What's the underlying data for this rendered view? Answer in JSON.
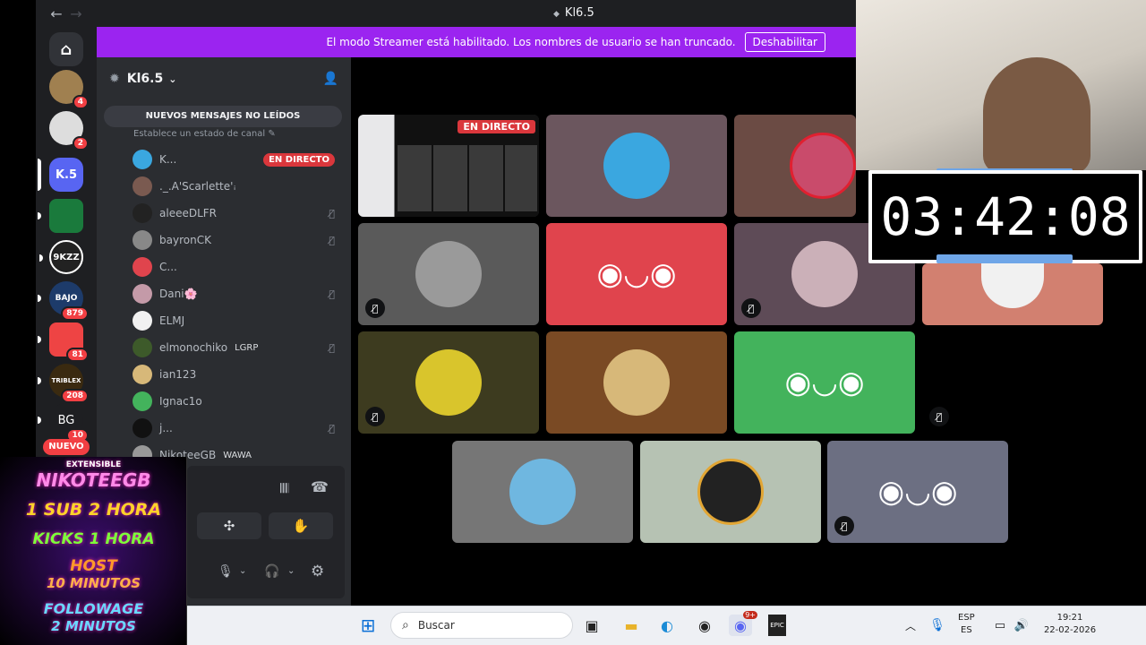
{
  "window": {
    "title": "Kl6.5",
    "back": "←",
    "forward": "→"
  },
  "banner": {
    "text": "El modo Streamer está habilitado. Los nombres de usuario se han truncado.",
    "button": "Deshabilitar"
  },
  "rail": {
    "servers": [
      {
        "label": "",
        "badge": "",
        "color": "#5865f2"
      },
      {
        "label": "",
        "badge": "4",
        "color": "#a08050"
      },
      {
        "label": "",
        "badge": "2",
        "color": "#222"
      },
      {
        "label": "K.5",
        "badge": "",
        "color": "#5865f2"
      },
      {
        "label": "",
        "badge": "",
        "color": "#1a7a3c"
      },
      {
        "label": "9KZZ",
        "badge": "",
        "color": "#222"
      },
      {
        "label": "BAJO",
        "badge": "879",
        "color": "#1d3b6a"
      },
      {
        "label": "",
        "badge": "81",
        "color": "#e44"
      },
      {
        "label": "TRIBLEX",
        "badge": "208",
        "color": "#3a2a10"
      },
      {
        "label": "BG",
        "badge": "10",
        "color": "#1e1f22"
      }
    ],
    "nuevo": "NUEVO"
  },
  "guild": {
    "name": "Kl6.5"
  },
  "channel": {
    "new_messages": "NUEVOS MENSAJES NO LEÍDOS",
    "status_hint": "Establece un estado de canal",
    "live_label": "EN DIRECTO",
    "members": [
      {
        "name": "K...",
        "live": true,
        "muted": false,
        "tag": ""
      },
      {
        "name": "._.A'Scarlette'ꜟ",
        "live": false,
        "muted": false,
        "tag": ""
      },
      {
        "name": "aleeeDLFR",
        "live": false,
        "muted": true,
        "tag": ""
      },
      {
        "name": "bayronCK",
        "live": false,
        "muted": true,
        "tag": ""
      },
      {
        "name": "C...",
        "live": false,
        "muted": false,
        "tag": ""
      },
      {
        "name": "Dani🌸",
        "live": false,
        "muted": true,
        "tag": ""
      },
      {
        "name": "ELMJ",
        "live": false,
        "muted": false,
        "tag": ""
      },
      {
        "name": "elmonochiko",
        "live": false,
        "muted": true,
        "tag": "LGRP"
      },
      {
        "name": "ian123",
        "live": false,
        "muted": false,
        "tag": ""
      },
      {
        "name": "Ignac1o",
        "live": false,
        "muted": false,
        "tag": ""
      },
      {
        "name": "j...",
        "live": false,
        "muted": true,
        "tag": ""
      },
      {
        "name": "NikoteeGB",
        "live": false,
        "muted": false,
        "tag": "WAWA"
      }
    ]
  },
  "stage": {
    "live_tag": "EN DIRECTO"
  },
  "timer": {
    "value": "03:42:08"
  },
  "promo": {
    "line1": "EXTENSIBLE",
    "line2": "NIKOTEEGB",
    "line3": "1 SUB 2 HORA",
    "line4": "KICKS 1 HORA",
    "line5": "HOST",
    "line6": "10 MINUTOS",
    "line7": "FOLLOWAGE",
    "line8": "2 MINUTOS"
  },
  "taskbar": {
    "search_placeholder": "Buscar",
    "discord_badge": "9+",
    "lang": "ESP",
    "lang2": "ES",
    "time": "19:21",
    "date": "22-02-2026"
  },
  "colors": {
    "blurple": "#5865f2",
    "red": "#da373c",
    "green": "#43b35c",
    "banner": "#9b24f0"
  }
}
